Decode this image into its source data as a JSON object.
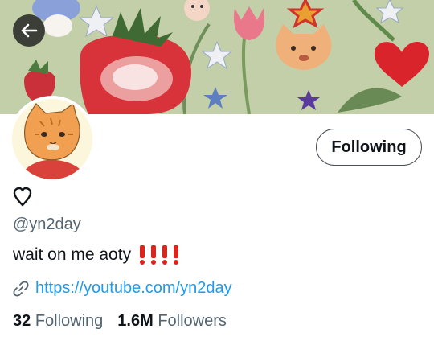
{
  "header": {
    "back_icon": "arrow-left-icon",
    "banner_colors": {
      "background": "#b8c9a0",
      "strawberry": "#d8323a",
      "heart": "#d8242a"
    }
  },
  "profile": {
    "name_icon": "heart-outline-icon",
    "handle": "@yn2day",
    "bio": "wait on me aoty",
    "bio_emoji": "❗❗❗❗",
    "link": "https://youtube.com/yn2day",
    "link_icon": "link-icon",
    "following_button": "Following",
    "stats": {
      "following_count": "32",
      "following_label": "Following",
      "followers_count": "1.6M",
      "followers_label": "Followers"
    }
  },
  "colors": {
    "link": "#1d9bf0",
    "muted": "#536471",
    "text": "#0f1419",
    "exclaim": "#d9261c"
  }
}
